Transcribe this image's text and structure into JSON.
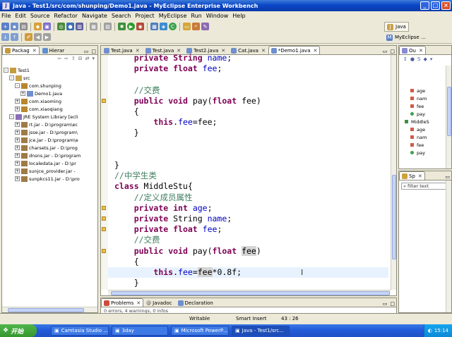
{
  "window": {
    "title": "Java - Test1/src/com/shunping/Demo1.java - MyEclipse Enterprise Workbench"
  },
  "menu": [
    "File",
    "Edit",
    "Source",
    "Refactor",
    "Navigate",
    "Search",
    "Project",
    "MyEclipse",
    "Run",
    "Window",
    "Help"
  ],
  "perspectives": {
    "java": "Java",
    "myeclipse": "MyEclipse ..."
  },
  "left_panel": {
    "tabs": [
      "Packag",
      "Hierar"
    ],
    "tree": [
      {
        "label": "Test1",
        "indent": 0,
        "toggle": "-",
        "icon": "project"
      },
      {
        "label": "src",
        "indent": 1,
        "toggle": "-",
        "icon": "srcfolder"
      },
      {
        "label": "com.shunping",
        "indent": 2,
        "toggle": "-",
        "icon": "package"
      },
      {
        "label": "Demo1.java",
        "indent": 3,
        "toggle": "+",
        "icon": "javafile"
      },
      {
        "label": "com.xiaoming",
        "indent": 2,
        "toggle": "+",
        "icon": "package"
      },
      {
        "label": "com.xiaoqiang",
        "indent": 2,
        "toggle": "+",
        "icon": "package"
      },
      {
        "label": "JRE System Library [ecli",
        "indent": 1,
        "toggle": "-",
        "icon": "library"
      },
      {
        "label": "rt.jar - D:\\program\\ec",
        "indent": 2,
        "toggle": "+",
        "icon": "jar"
      },
      {
        "label": "jsse.jar - D:\\program\\",
        "indent": 2,
        "toggle": "+",
        "icon": "jar"
      },
      {
        "label": "jce.jar - D:\\program\\e",
        "indent": 2,
        "toggle": "+",
        "icon": "jar"
      },
      {
        "label": "charsets.jar - D:\\prog",
        "indent": 2,
        "toggle": "+",
        "icon": "jar"
      },
      {
        "label": "dnsns.jar - D:\\program",
        "indent": 2,
        "toggle": "+",
        "icon": "jar"
      },
      {
        "label": "localedata.jar - D:\\pr",
        "indent": 2,
        "toggle": "+",
        "icon": "jar"
      },
      {
        "label": "sunjce_provider.jar - ",
        "indent": 2,
        "toggle": "+",
        "icon": "jar"
      },
      {
        "label": "sunpkcs11.jar - D:\\pro",
        "indent": 2,
        "toggle": "+",
        "icon": "jar"
      }
    ]
  },
  "editor": {
    "tabs": [
      "Test.java",
      "Test.java",
      "Test2.java",
      "Cat.java",
      "*Demo1.java"
    ],
    "active_tab": 4,
    "lines": [
      [
        {
          "t": "    "
        },
        {
          "t": "private",
          "c": "kw"
        },
        {
          "t": " "
        },
        {
          "t": "String",
          "c": "kw"
        },
        {
          "t": " "
        },
        {
          "t": "name",
          "c": "fld"
        },
        {
          "t": ";"
        }
      ],
      [
        {
          "t": "    "
        },
        {
          "t": "private",
          "c": "kw"
        },
        {
          "t": " "
        },
        {
          "t": "float",
          "c": "kw"
        },
        {
          "t": " "
        },
        {
          "t": "fee",
          "c": "fld"
        },
        {
          "t": ";"
        }
      ],
      [
        {
          "t": ""
        }
      ],
      [
        {
          "t": "    "
        },
        {
          "t": "//交费",
          "c": "cm"
        }
      ],
      [
        {
          "t": "    "
        },
        {
          "t": "public",
          "c": "kw"
        },
        {
          "t": " "
        },
        {
          "t": "void",
          "c": "kw"
        },
        {
          "t": " pay("
        },
        {
          "t": "float",
          "c": "kw"
        },
        {
          "t": " fee)"
        }
      ],
      [
        {
          "t": "    {"
        }
      ],
      [
        {
          "t": "        "
        },
        {
          "t": "this",
          "c": "kw"
        },
        {
          "t": "."
        },
        {
          "t": "fee",
          "c": "fld"
        },
        {
          "t": "=fee;"
        }
      ],
      [
        {
          "t": "    }"
        }
      ],
      [
        {
          "t": ""
        }
      ],
      [
        {
          "t": ""
        }
      ],
      [
        {
          "t": "}"
        }
      ],
      [
        {
          "t": "//中学生类",
          "c": "cm"
        }
      ],
      [
        {
          "t": "class",
          "c": "kw"
        },
        {
          "t": " MiddleStu{"
        }
      ],
      [
        {
          "t": "    "
        },
        {
          "t": "//定义成员属性",
          "c": "cm"
        }
      ],
      [
        {
          "t": "    "
        },
        {
          "t": "private",
          "c": "kw"
        },
        {
          "t": " "
        },
        {
          "t": "int",
          "c": "kw"
        },
        {
          "t": " "
        },
        {
          "t": "age",
          "c": "fld"
        },
        {
          "t": ";"
        }
      ],
      [
        {
          "t": "    "
        },
        {
          "t": "private",
          "c": "kw"
        },
        {
          "t": " String "
        },
        {
          "t": "name",
          "c": "fld"
        },
        {
          "t": ";"
        }
      ],
      [
        {
          "t": "    "
        },
        {
          "t": "private",
          "c": "kw"
        },
        {
          "t": " "
        },
        {
          "t": "float",
          "c": "kw"
        },
        {
          "t": " "
        },
        {
          "t": "fee",
          "c": "fld"
        },
        {
          "t": ";"
        }
      ],
      [
        {
          "t": "    "
        },
        {
          "t": "//交费",
          "c": "cm"
        }
      ],
      [
        {
          "t": "    "
        },
        {
          "t": "public",
          "c": "kw"
        },
        {
          "t": " "
        },
        {
          "t": "void",
          "c": "kw"
        },
        {
          "t": " pay("
        },
        {
          "t": "float",
          "c": "kw"
        },
        {
          "t": " "
        },
        {
          "t": "fee",
          "c": "hl"
        },
        {
          "t": ")"
        }
      ],
      [
        {
          "t": "    {"
        }
      ],
      [
        {
          "t": "        "
        },
        {
          "t": "this",
          "c": "kw"
        },
        {
          "t": "."
        },
        {
          "t": "fee",
          "c": "fld"
        },
        {
          "t": "="
        },
        {
          "t": "fee",
          "c": "hl"
        },
        {
          "t": "*0.8f;"
        }
      ],
      [
        {
          "t": "    }"
        }
      ]
    ]
  },
  "outline": {
    "tab": "Ou",
    "items": [
      {
        "label": "age",
        "indent": 2
      },
      {
        "label": "nam",
        "indent": 2
      },
      {
        "label": "fee",
        "indent": 2
      },
      {
        "label": "pay",
        "indent": 2
      },
      {
        "label": "MiddleS",
        "indent": 1
      },
      {
        "label": "age",
        "indent": 2
      },
      {
        "label": "nam",
        "indent": 2
      },
      {
        "label": "fee",
        "indent": 2
      },
      {
        "label": "pay",
        "indent": 2
      }
    ]
  },
  "snippets": {
    "tab": "Sp",
    "filter": "« filter text"
  },
  "bottom_panel": {
    "tabs": [
      "Problems",
      "Javadoc",
      "Declaration"
    ],
    "summary": "0 errors, 4 warnings, 0 infos"
  },
  "status": {
    "writable": "Writable",
    "insert": "Smart Insert",
    "position": "43 : 26"
  },
  "taskbar": {
    "start": "开始",
    "tasks": [
      "Camtasia Studio ...",
      "3day",
      "Microsoft PowerP...",
      "Java - Test1/src..."
    ],
    "active_task": 3,
    "clock": "15:14"
  },
  "colors": {
    "keyword": "#7f0055",
    "field": "#0000c0",
    "comment": "#3f7f5f",
    "titlebar": "#0a47c8",
    "taskbar": "#245edb"
  }
}
